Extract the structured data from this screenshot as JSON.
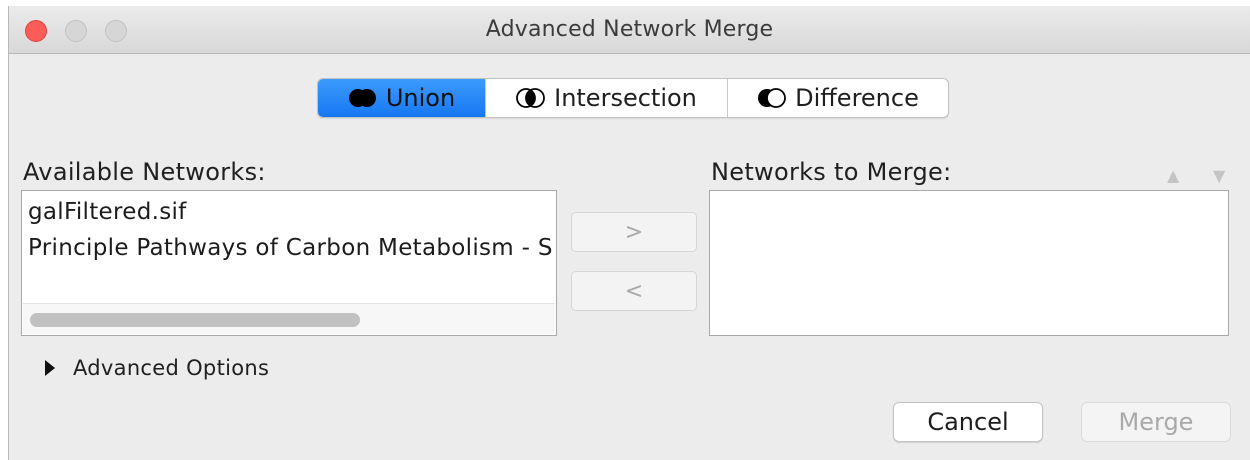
{
  "window": {
    "title": "Advanced Network Merge"
  },
  "mode_tabs": [
    {
      "label": "Union",
      "icon": "union-icon",
      "selected": true
    },
    {
      "label": "Intersection",
      "icon": "intersection-icon",
      "selected": false
    },
    {
      "label": "Difference",
      "icon": "difference-icon",
      "selected": false
    }
  ],
  "available": {
    "label": "Available Networks:",
    "items": [
      "galFiltered.sif",
      "Principle Pathways of Carbon Metabolism - S"
    ]
  },
  "transfer": {
    "add_label": ">",
    "remove_label": "<"
  },
  "to_merge": {
    "label": "Networks to Merge:",
    "items": [],
    "up_icon": "move-up-icon",
    "down_icon": "move-down-icon"
  },
  "advanced": {
    "label": "Advanced Options",
    "expanded": false
  },
  "footer": {
    "cancel_label": "Cancel",
    "merge_label": "Merge",
    "merge_enabled": false
  },
  "colors": {
    "accent": "#1a7cf5",
    "close": "#fc5b57",
    "window_bg": "#ececec"
  }
}
